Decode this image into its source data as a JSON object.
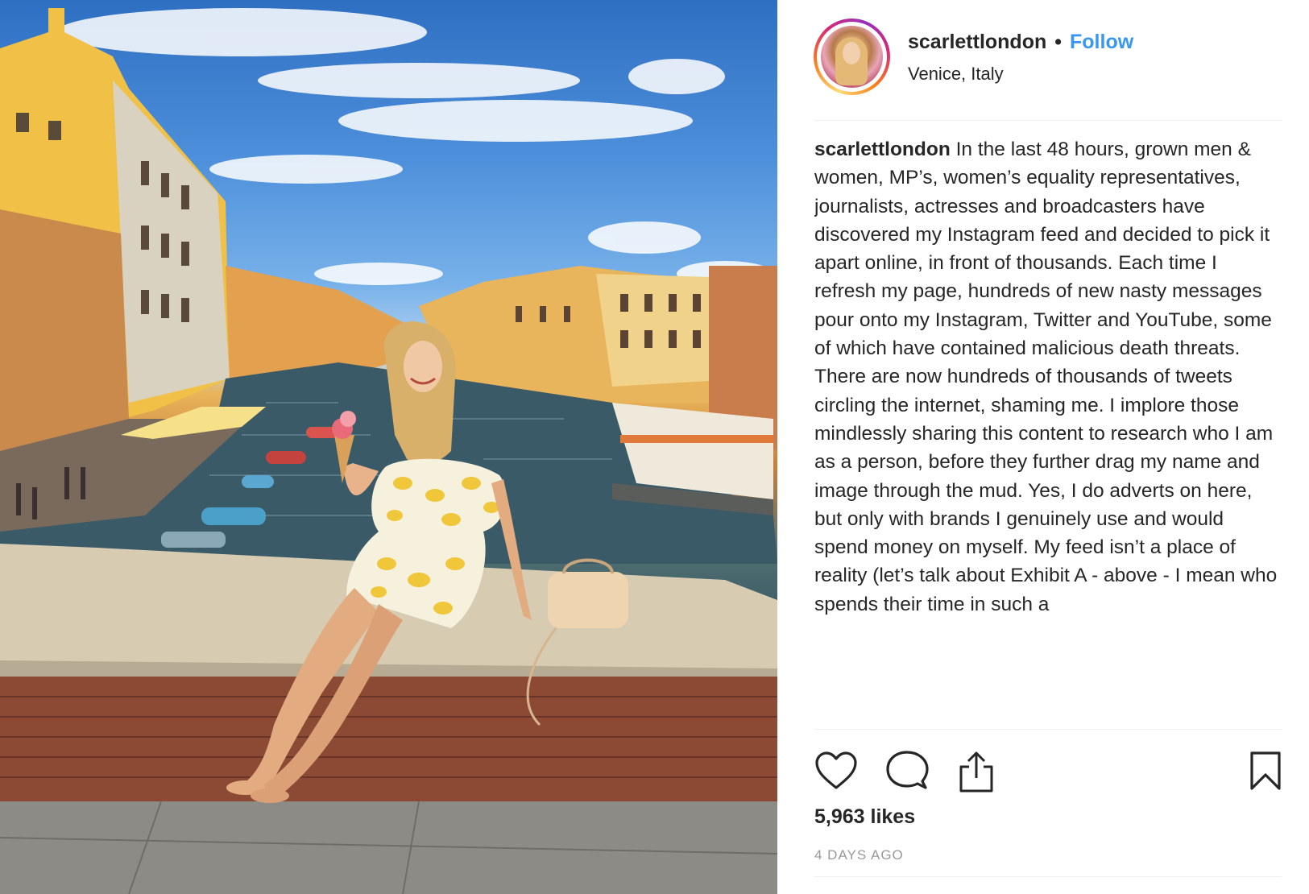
{
  "post": {
    "username": "scarlettlondon",
    "separator": "•",
    "follow_label": "Follow",
    "location": "Venice, Italy",
    "caption_username": "scarlettlondon",
    "caption_text": " In the last 48 hours, grown men & women, MP’s, women’s equality representatives, journalists, actresses and broadcasters have discovered my Instagram feed and decided to pick it apart online, in front of thousands. Each time I refresh my page, hundreds of new nasty messages pour onto my Instagram, Twitter and YouTube, some of which have contained malicious death threats. There are now hundreds of thousands of tweets circling the internet, shaming me. I implore those mindlessly sharing this content to research who I am as a person, before they further drag my name and image through the mud. Yes, I do adverts on here, but only with brands I genuinely use and would spend money on myself. My feed isn’t a place of reality (let’s talk about Exhibit A - above - I mean who spends their time in such a",
    "likes": "5,963 likes",
    "timestamp": "4 DAYS AGO"
  },
  "icons": {
    "like": "heart-icon",
    "comment": "comment-icon",
    "share": "share-icon",
    "save": "bookmark-icon"
  },
  "colors": {
    "follow": "#3897f0",
    "text": "#262626",
    "muted": "#999999",
    "divider": "#efefef"
  }
}
